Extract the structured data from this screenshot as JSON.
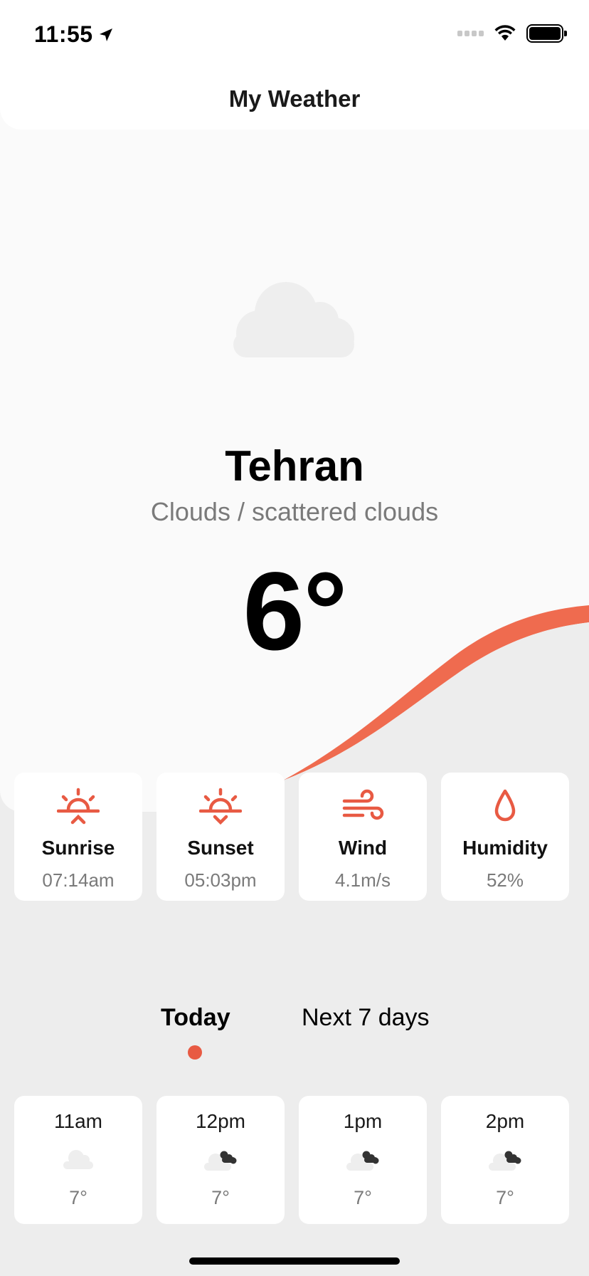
{
  "status_bar": {
    "time": "11:55"
  },
  "header": {
    "title": "My Weather"
  },
  "current": {
    "city": "Tehran",
    "description": "Clouds / scattered clouds",
    "temperature": "6°"
  },
  "stats": [
    {
      "label": "Sunrise",
      "value": "07:14am",
      "icon": "sunrise-icon"
    },
    {
      "label": "Sunset",
      "value": "05:03pm",
      "icon": "sunset-icon"
    },
    {
      "label": "Wind",
      "value": "4.1m/s",
      "icon": "wind-icon"
    },
    {
      "label": "Humidity",
      "value": "52%",
      "icon": "droplet-icon"
    }
  ],
  "tabs": [
    {
      "label": "Today",
      "active": true
    },
    {
      "label": "Next 7 days",
      "active": false
    }
  ],
  "hourly": [
    {
      "time": "11am",
      "temp": "7°",
      "icon": "cloud-icon"
    },
    {
      "time": "12pm",
      "temp": "7°",
      "icon": "cloud-scattered-icon"
    },
    {
      "time": "1pm",
      "temp": "7°",
      "icon": "cloud-scattered-icon"
    },
    {
      "time": "2pm",
      "temp": "7°",
      "icon": "cloud-scattered-icon"
    }
  ],
  "colors": {
    "accent": "#e85a43",
    "wave": "#ef6b4f",
    "hero_bg": "#fafafa",
    "page_bg": "#ededed",
    "muted_text": "#7a7a7a"
  }
}
